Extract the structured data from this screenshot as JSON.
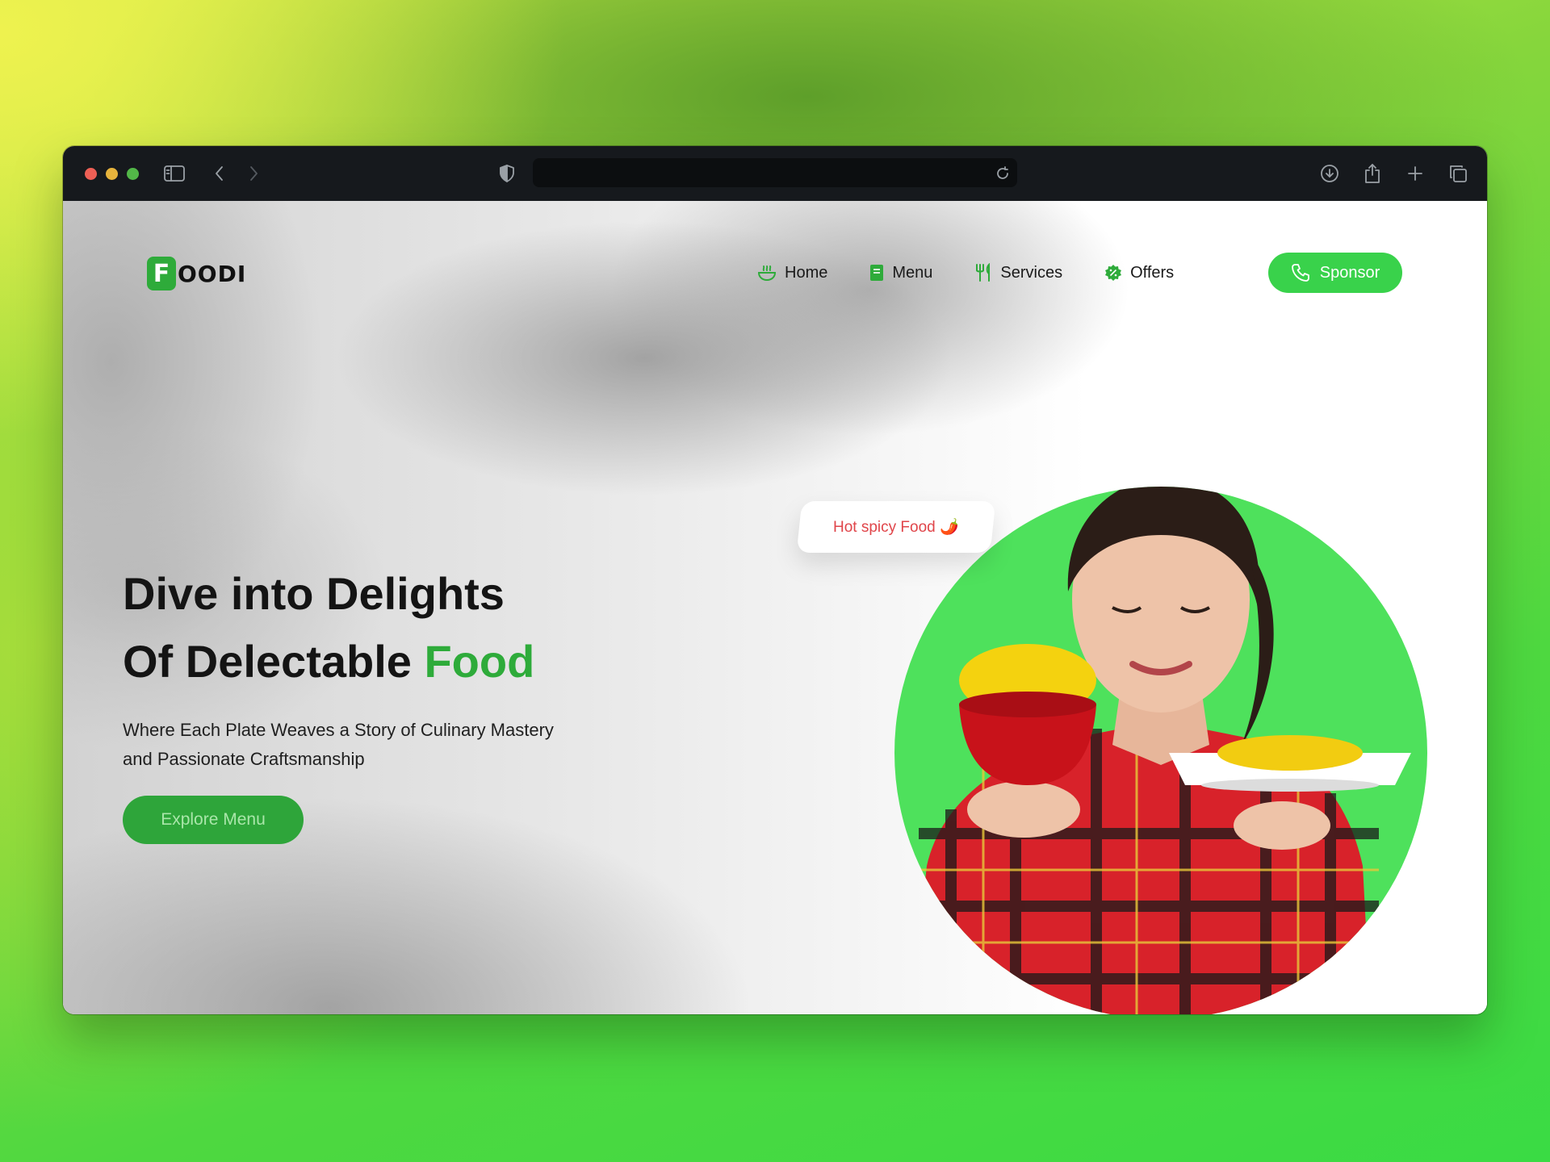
{
  "browser": {
    "icons": [
      "sidebar-icon",
      "back-icon",
      "forward-icon",
      "shield-icon",
      "reload-icon",
      "download-icon",
      "share-icon",
      "new-tab-icon",
      "tabs-overview-icon"
    ]
  },
  "site": {
    "logo_mark": "F",
    "logo_text": "OODI",
    "nav": [
      {
        "label": "Home",
        "icon": "bowl-icon"
      },
      {
        "label": "Menu",
        "icon": "menu-book-icon"
      },
      {
        "label": "Services",
        "icon": "fork-knife-icon"
      },
      {
        "label": "Offers",
        "icon": "discount-badge-icon"
      }
    ],
    "sponsor_label": "Sponsor",
    "accent": "#2eab3a",
    "bright_green": "#39d24b"
  },
  "hero": {
    "title_line1": "Dive into Delights",
    "title_line2_plain": "Of Delectable ",
    "title_line2_accent": "Food",
    "subtitle": "Where Each Plate Weaves a Story of Culinary Mastery and Passionate Craftsmanship",
    "cta_label": "Explore Menu",
    "badge_text": "Hot spicy Food 🌶️",
    "badge_color": "#e0454a"
  },
  "dock": {
    "icons": [
      "comment-icon",
      "eye-icon",
      "list-icon"
    ]
  }
}
